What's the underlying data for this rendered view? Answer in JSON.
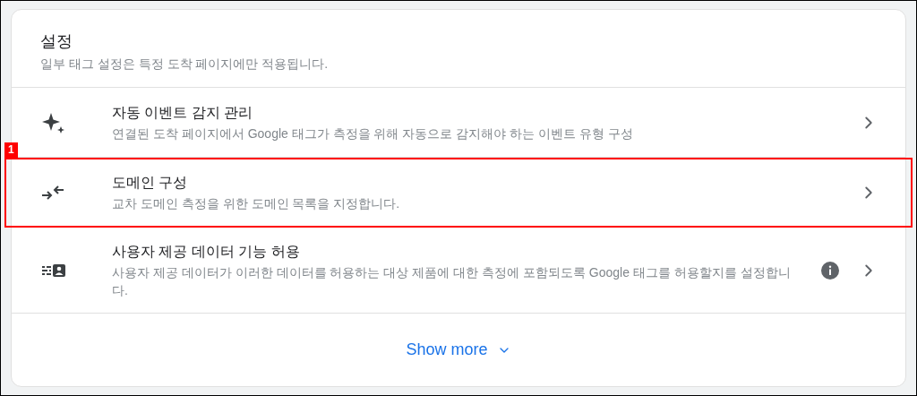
{
  "header": {
    "title": "설정",
    "subtitle": "일부 태그 설정은 특정 도착 페이지에만 적용됩니다."
  },
  "rows": [
    {
      "kind": "sparkle",
      "title": "자동 이벤트 감지 관리",
      "description": "연결된 도착 페이지에서 Google 태그가 측정을 위해 자동으로 감지해야 하는 이벤트 유형 구성",
      "info": false,
      "highlighted": false
    },
    {
      "kind": "arrows",
      "title": "도메인 구성",
      "description": "교차 도메인 측정을 위한 도메인 목록을 지정합니다.",
      "info": false,
      "highlighted": true,
      "badge": "1"
    },
    {
      "kind": "userdata",
      "title": "사용자 제공 데이터 기능 허용",
      "description": "사용자 제공 데이터가 이러한 데이터를 허용하는 대상 제품에 대한 측정에 포함되도록 Google 태그를 허용할지를 설정합니다.",
      "info": true,
      "highlighted": false
    }
  ],
  "show_more": "Show more"
}
